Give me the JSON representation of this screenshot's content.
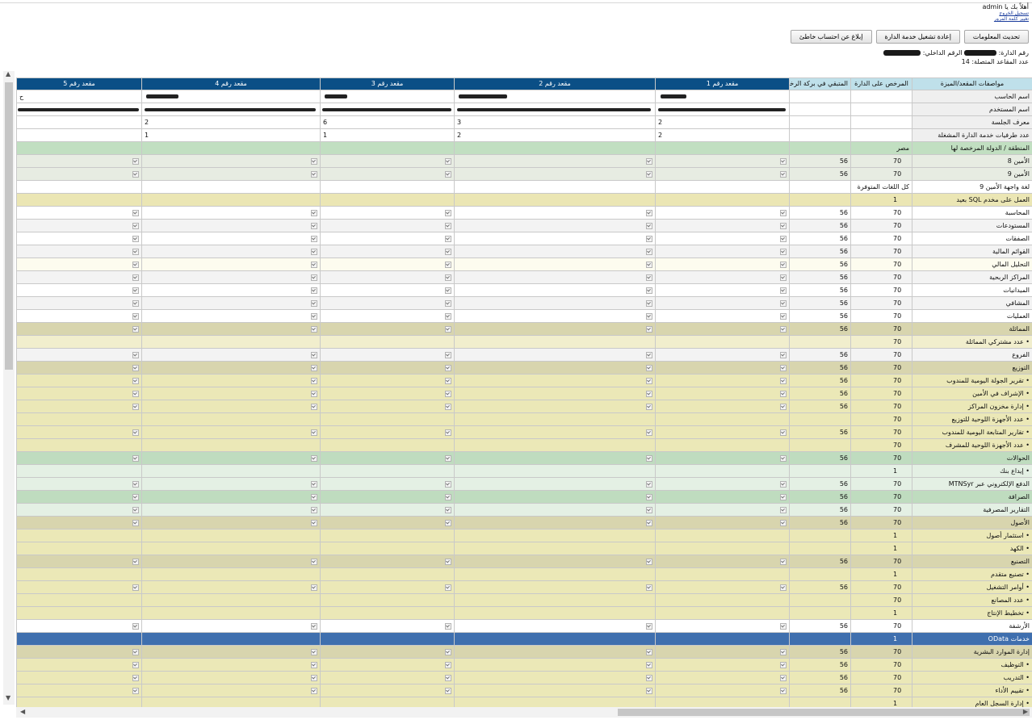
{
  "header": {
    "greeting": "أهلاً بك يا admin",
    "links": [
      "تسجيل الخروج",
      "تغيير كلمة المرور"
    ]
  },
  "buttons": [
    "تحديث المعلومات",
    "إعادة تشغيل خدمة الدارة",
    "إبلاغ عن احتساب خاطئ"
  ],
  "info": {
    "line1_a": "رقم الدارة:",
    "line1_b": "الرقم الداخلي:",
    "line2": "عدد المقاعد المتصلة: 14"
  },
  "columns": [
    "مواصفات المقعد/الميزة",
    "المرخص على الدارة",
    "المتبقي في بركة الرخص",
    "مقعد رقم 1",
    "مقعد رقم 2",
    "مقعد رقم 3",
    "مقعد رقم 4",
    "مقعد رقم 5"
  ],
  "info_rows": [
    {
      "label": "اسم الحاسب",
      "seat5": "ح"
    },
    {
      "label": "اسم المستخدم"
    },
    {
      "label": "معرف الجلسة",
      "seats": [
        "2",
        "3",
        "6",
        "2",
        ""
      ]
    },
    {
      "label": "عدد طرفيات خدمة الدارة المشغلة",
      "seats": [
        "2",
        "2",
        "1",
        "1",
        ""
      ]
    }
  ],
  "rows": [
    {
      "label": "المنطقة / الدولة المرخصة لها",
      "licensed": "مصر",
      "remaining": "",
      "checks": false,
      "color": "#c1dfc1"
    },
    {
      "label": "الأمين 8",
      "licensed": "70",
      "remaining": "56",
      "checks": true,
      "color": "#e7ece2"
    },
    {
      "label": "الأمين 9",
      "licensed": "70",
      "remaining": "56",
      "checks": true,
      "color": "#e7ece2"
    },
    {
      "label": "لغة واجهة الأمين 9",
      "licensed": "كل اللغات المتوفرة",
      "remaining": "",
      "checks": false,
      "color": "#ffffff"
    },
    {
      "label": "العمل على مخدم SQL بعيد",
      "licensed": "1",
      "remaining": "",
      "checks": false,
      "color": "#ebe6b4"
    },
    {
      "label": "المحاسبة",
      "licensed": "70",
      "remaining": "56",
      "checks": true,
      "color": "#ffffff"
    },
    {
      "label": "المستودعات",
      "licensed": "70",
      "remaining": "56",
      "checks": true,
      "color": "#f3f3f3"
    },
    {
      "label": "الصفقات",
      "licensed": "70",
      "remaining": "56",
      "checks": true,
      "color": "#ffffff"
    },
    {
      "label": "القوائم المالية",
      "licensed": "70",
      "remaining": "56",
      "checks": true,
      "color": "#f3f3f3"
    },
    {
      "label": "التحليل المالي",
      "licensed": "70",
      "remaining": "56",
      "checks": true,
      "color": "#fdfcef"
    },
    {
      "label": "المراكز الربحية",
      "licensed": "70",
      "remaining": "56",
      "checks": true,
      "color": "#f3f3f3"
    },
    {
      "label": "الميدانيات",
      "licensed": "70",
      "remaining": "56",
      "checks": true,
      "color": "#ffffff"
    },
    {
      "label": "المشافي",
      "licensed": "70",
      "remaining": "56",
      "checks": true,
      "color": "#f3f3f3"
    },
    {
      "label": "العمليات",
      "licensed": "70",
      "remaining": "56",
      "checks": true,
      "color": "#ffffff"
    },
    {
      "label": "المماثلة",
      "licensed": "70",
      "remaining": "56",
      "checks": true,
      "color": "#d8d5ae"
    },
    {
      "label": "• عدد مشتركي المماثلة",
      "licensed": "70",
      "remaining": "",
      "checks": false,
      "color": "#f1eecd"
    },
    {
      "label": "الفروع",
      "licensed": "70",
      "remaining": "56",
      "checks": true,
      "color": "#f3f3f3"
    },
    {
      "label": "التوزيع",
      "licensed": "70",
      "remaining": "56",
      "checks": true,
      "color": "#d8d5ae"
    },
    {
      "label": "• تقرير الجولة اليومية للمندوب",
      "licensed": "70",
      "remaining": "56",
      "checks": true,
      "color": "#ebe8b7"
    },
    {
      "label": "• الإشراف في الأمين",
      "licensed": "70",
      "remaining": "56",
      "checks": true,
      "color": "#ebe8b7"
    },
    {
      "label": "• إدارة مخزون المراكز",
      "licensed": "70",
      "remaining": "56",
      "checks": true,
      "color": "#ebe8b7"
    },
    {
      "label": "• عدد الأجهزة اللوحية للتوزيع",
      "licensed": "70",
      "remaining": "",
      "checks": false,
      "color": "#ebe8b7"
    },
    {
      "label": "• تقارير المتابعة اليومية للمندوب",
      "licensed": "70",
      "remaining": "56",
      "checks": true,
      "color": "#ebe8b7"
    },
    {
      "label": "• عدد الأجهزة اللوحية للمشرف",
      "licensed": "70",
      "remaining": "",
      "checks": false,
      "color": "#ebe8b7"
    },
    {
      "label": "الحوالات",
      "licensed": "70",
      "remaining": "56",
      "checks": true,
      "color": "#bfdcbf"
    },
    {
      "label": "• إيداع بنك",
      "licensed": "1",
      "remaining": "",
      "checks": false,
      "color": "#e4f0e4"
    },
    {
      "label": "الدفع الإلكتروني عبر MTNSyr",
      "licensed": "70",
      "remaining": "56",
      "checks": true,
      "color": "#e4f0e4"
    },
    {
      "label": "الصرافة",
      "licensed": "70",
      "remaining": "56",
      "checks": true,
      "color": "#bfdcbf"
    },
    {
      "label": "التقارير المصرفية",
      "licensed": "70",
      "remaining": "56",
      "checks": true,
      "color": "#e4f0e4"
    },
    {
      "label": "الأصول",
      "licensed": "70",
      "remaining": "56",
      "checks": true,
      "color": "#d8d5ae"
    },
    {
      "label": "• استثمار أصول",
      "licensed": "1",
      "remaining": "",
      "checks": false,
      "color": "#ebe8b7"
    },
    {
      "label": "• الكهد",
      "licensed": "1",
      "remaining": "",
      "checks": false,
      "color": "#ebe8b7"
    },
    {
      "label": "التصنيع",
      "licensed": "70",
      "remaining": "56",
      "checks": true,
      "color": "#d8d5ae"
    },
    {
      "label": "• تصنيع متقدم",
      "licensed": "1",
      "remaining": "",
      "checks": false,
      "color": "#ebe8b7"
    },
    {
      "label": "• أوامر التشغيل",
      "licensed": "70",
      "remaining": "56",
      "checks": true,
      "color": "#ebe8b7"
    },
    {
      "label": "• عدد المصانع",
      "licensed": "70",
      "remaining": "",
      "checks": false,
      "color": "#ebe8b7"
    },
    {
      "label": "• تخطيط الإنتاج",
      "licensed": "1",
      "remaining": "",
      "checks": false,
      "color": "#ebe8b7"
    },
    {
      "label": "الأرشفة",
      "licensed": "70",
      "remaining": "56",
      "checks": true,
      "color": "#ffffff"
    },
    {
      "label": "خدمات OData",
      "licensed": "1",
      "remaining": "",
      "checks": false,
      "color": "#3f6fae",
      "text_color": "#ffffff"
    },
    {
      "label": "إدارة الموارد البشرية",
      "licensed": "70",
      "remaining": "56",
      "checks": true,
      "color": "#d8d5ae"
    },
    {
      "label": "• التوظيف",
      "licensed": "70",
      "remaining": "56",
      "checks": true,
      "color": "#ebe8b7"
    },
    {
      "label": "• التدريب",
      "licensed": "70",
      "remaining": "56",
      "checks": true,
      "color": "#ebe8b7"
    },
    {
      "label": "• تقييم الأداء",
      "licensed": "70",
      "remaining": "56",
      "checks": true,
      "color": "#ebe8b7"
    },
    {
      "label": "• إدارة السجل العام",
      "licensed": "1",
      "remaining": "",
      "checks": false,
      "color": "#ebe8b7"
    }
  ]
}
